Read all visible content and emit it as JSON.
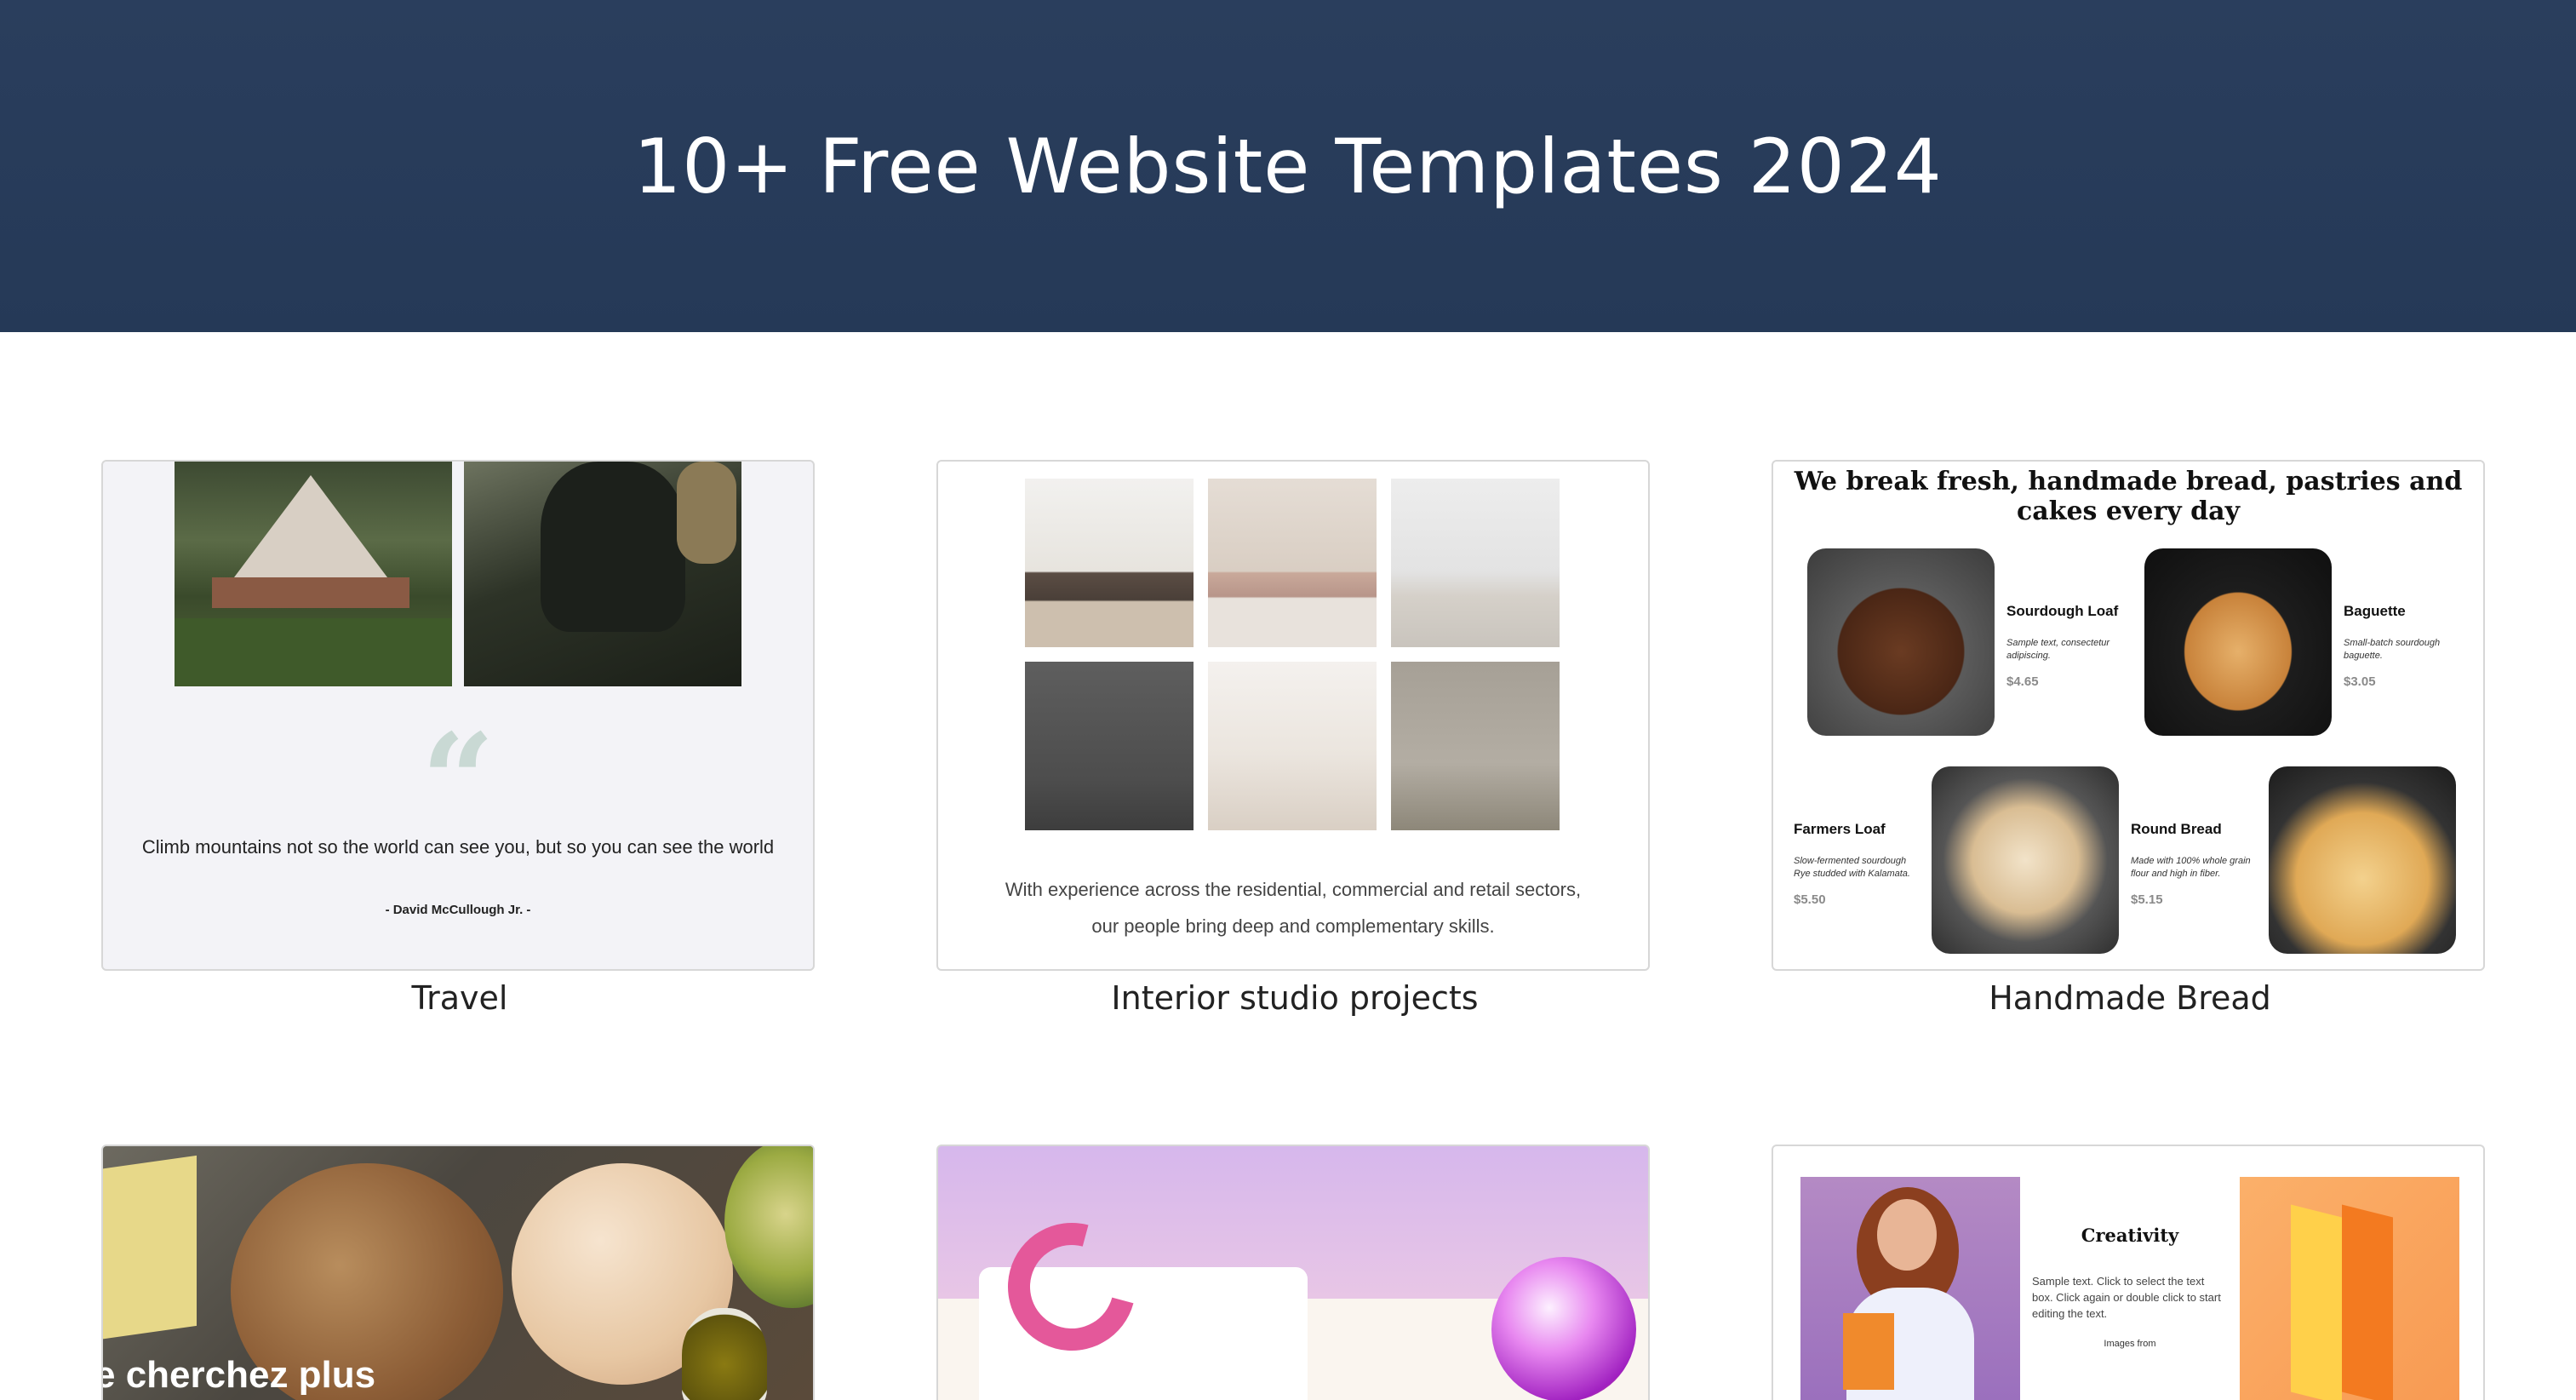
{
  "header": {
    "title": "10+ Free Website Templates 2024"
  },
  "templates": [
    {
      "caption": "Travel",
      "quote": "Climb mountains not so the world can see you, but so you can see the world",
      "author": "- David McCullough Jr. -"
    },
    {
      "caption": "Interior studio projects",
      "text_line1": "With experience across the residential, commercial and retail sectors,",
      "text_line2": "our people bring deep and complementary skills."
    },
    {
      "caption": "Handmade Bread",
      "title": "We break fresh, handmade bread, pastries and cakes every day",
      "items": [
        {
          "name": "Sourdough Loaf",
          "desc": "Sample text, consectetur adipiscing.",
          "price": "$4.65"
        },
        {
          "name": "Baguette",
          "desc": "Small-batch sourdough baguette.",
          "price": "$3.05"
        },
        {
          "name": "Farmers Loaf",
          "desc": "Slow-fermented sourdough Rye studded with Kalamata.",
          "price": "$5.50"
        },
        {
          "name": "Round Bread",
          "desc": "Made with 100% whole grain flour and high in fiber.",
          "price": "$5.15"
        }
      ]
    },
    {
      "text": "e cherchez plus"
    },
    {},
    {
      "title": "Creativity",
      "text": "Sample text. Click to select the text box. Click again or double click to start editing the text.",
      "images_from": "Images from"
    }
  ]
}
